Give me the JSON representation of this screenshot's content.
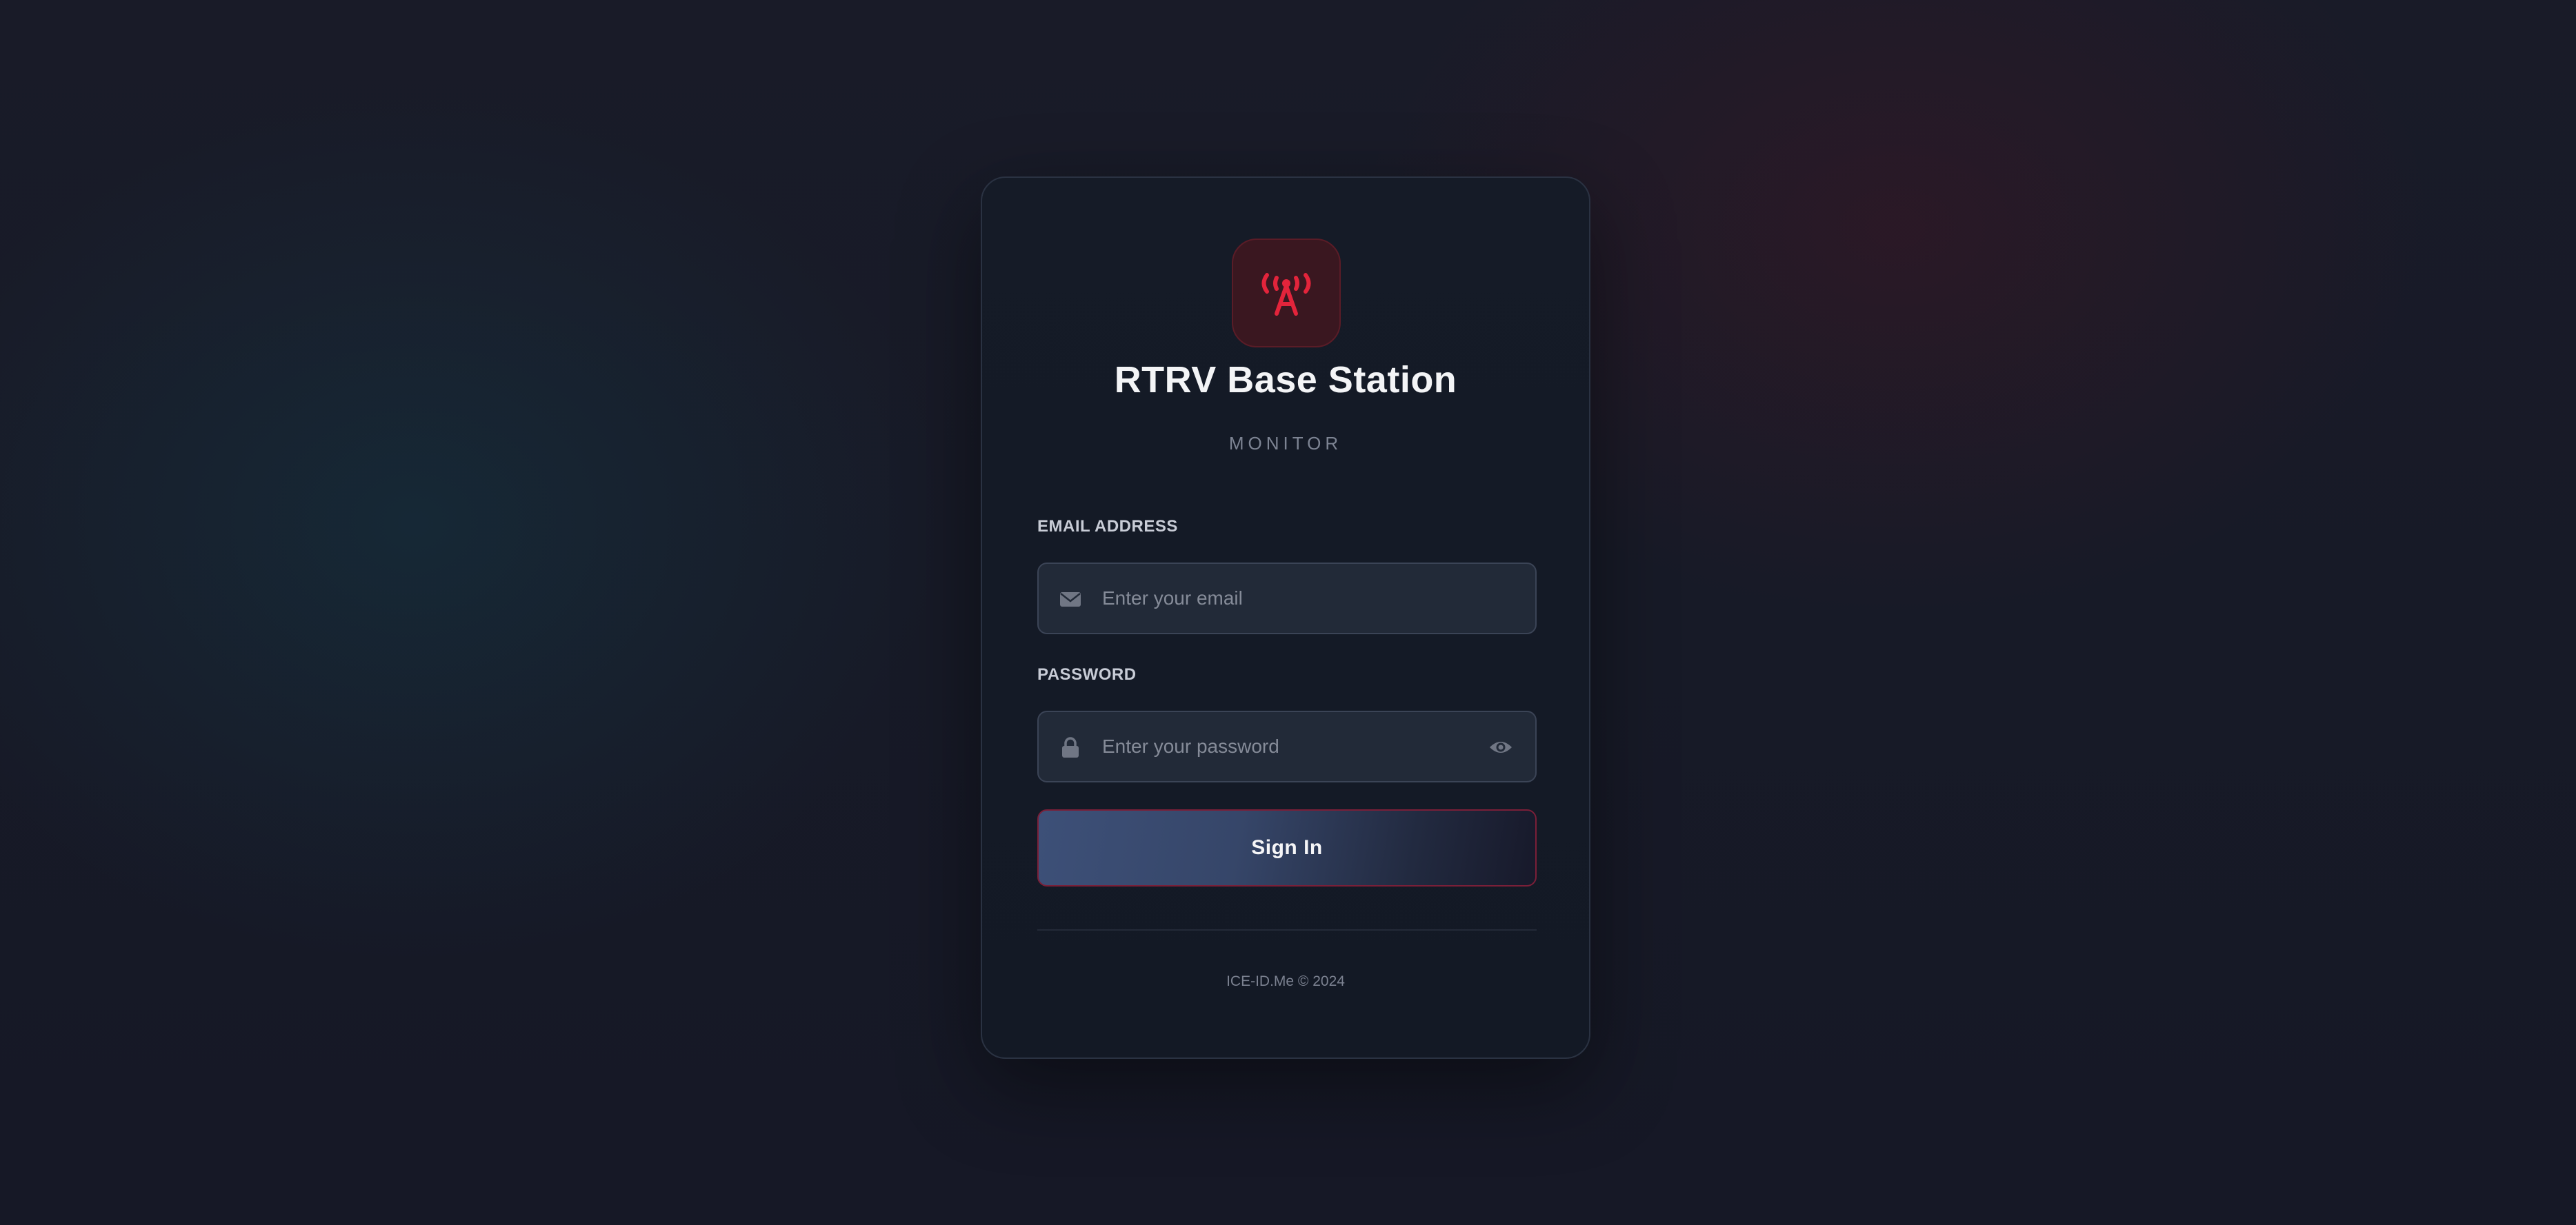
{
  "app": {
    "title": "RTRV Base Station",
    "subtitle": "MONITOR",
    "logo_icon": "broadcast-tower-icon",
    "accent_color": "#e3243b"
  },
  "login": {
    "email": {
      "label": "EMAIL ADDRESS",
      "placeholder": "Enter your email",
      "value": "",
      "icon": "envelope-icon"
    },
    "password": {
      "label": "PASSWORD",
      "placeholder": "Enter your password",
      "value": "",
      "icon": "lock-icon",
      "toggle_icon": "eye-icon"
    },
    "submit_label": "Sign In"
  },
  "footer": {
    "text": "ICE-ID.Me © 2024"
  }
}
